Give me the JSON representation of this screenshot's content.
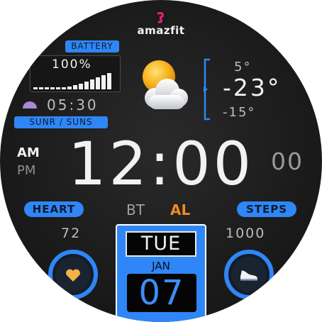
{
  "brand": {
    "name": "amazfit",
    "logo_color": "#e0207a"
  },
  "accent_color": "#2f86f6",
  "battery": {
    "label": "BATTERY",
    "percent_text": "100%",
    "level": 1.0
  },
  "sun": {
    "time": "05:30",
    "label": "SUNR / SUNS"
  },
  "weather": {
    "icon": "partly-cloudy-icon",
    "high": "5°",
    "current": "-23°",
    "low": "-15°"
  },
  "time": {
    "am": "AM",
    "pm": "PM",
    "hours_minutes": "12:00",
    "seconds": "00",
    "active_period": "AM"
  },
  "status": {
    "bt": "BT",
    "al": "AL",
    "al_color": "#f08a24"
  },
  "heart": {
    "label": "HEART",
    "value": "72",
    "icon": "heart-icon"
  },
  "steps": {
    "label": "STEPS",
    "value": "1000",
    "icon": "shoe-icon"
  },
  "date": {
    "weekday": "TUE",
    "month": "JAN",
    "day": "07"
  }
}
